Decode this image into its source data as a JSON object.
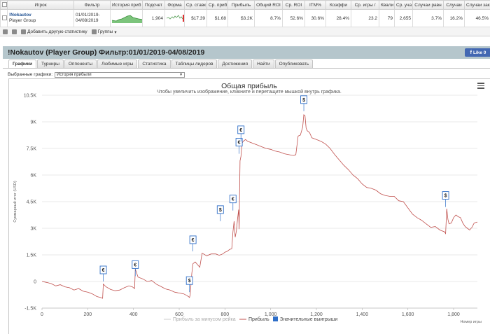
{
  "stats": {
    "columns": [
      "Игрок",
      "Фильтр",
      "История приб",
      "Подсчет",
      "Форма",
      "Ср. ставк",
      "Ср. приб",
      "Прибыль",
      "Общий ROI",
      "Ср. ROI",
      "ITM%",
      "Коэффи",
      "Ср. игры /",
      "Квали",
      "Ср. уча",
      "Случаи равн",
      "Случаи",
      "Случаи зак"
    ],
    "row": {
      "player_name": "!Nokautov",
      "player_group": "Player Group",
      "filter_from": "01/01/2019-",
      "filter_to": "04/08/2019",
      "count": "1,904",
      "avg_stake": "$17.39",
      "avg_profit": "$1.68",
      "profit": "$3.2K",
      "total_roi": "8.7%",
      "avg_roi": "52.6%",
      "itm": "30.6%",
      "coef": "28.4%",
      "avg_games": "23.2",
      "quali": "79",
      "avg_part": "2,655",
      "cases_eq": "3.7%",
      "cases": "16.2%",
      "cases_cl": "46.5%"
    }
  },
  "toolbar": {
    "add_label": "Добавить другую статистику",
    "groups_label": "Группы"
  },
  "header": {
    "title": "!Nokautov (Player Group) Фильтр:01/01/2019-04/08/2019",
    "like_label": "Like 0"
  },
  "tabs": [
    "Графики",
    "Турниры",
    "Оппоненты",
    "Любимые игры",
    "Статистика",
    "Таблицы лидеров",
    "Достижения",
    "Найти",
    "Опубликовать"
  ],
  "selector": {
    "label": "Выбранные графики:",
    "value": "История прибыли"
  },
  "chart_data": {
    "type": "line",
    "title": "Общая прибыль",
    "subtitle": "Чтобы увеличить изображение, кликните и перетащите мышкой внутрь графика.",
    "ylabel": "Суммарный итог (USD)",
    "xlabel": "Номер игры",
    "xlim": [
      0,
      1904
    ],
    "ylim": [
      -1500,
      10500
    ],
    "y_ticks": [
      "-1.5K",
      "0",
      "1.5K",
      "3K",
      "4.5K",
      "6K",
      "7.5K",
      "9K",
      "10.5K"
    ],
    "y_tick_values": [
      -1500,
      0,
      1500,
      3000,
      4500,
      6000,
      7500,
      9000,
      10500
    ],
    "x_ticks": [
      "0",
      "200",
      "400",
      "600",
      "800",
      "1,000",
      "1,200",
      "1,400",
      "1,600",
      "1,800"
    ],
    "x_tick_values": [
      0,
      200,
      400,
      600,
      800,
      1000,
      1200,
      1400,
      1600,
      1800
    ],
    "legend": [
      "Прибыль за минусом рейка",
      "Прибыль",
      "Значительные выигрыши"
    ],
    "legend_colors": [
      "#cccccc",
      "#c0504d",
      "#2f6fc8"
    ],
    "grid": true,
    "series": [
      {
        "name": "Прибыль",
        "color": "#c0504d",
        "x": [
          0,
          20,
          40,
          60,
          80,
          100,
          120,
          140,
          160,
          180,
          200,
          220,
          240,
          255,
          265,
          268,
          280,
          300,
          320,
          340,
          360,
          380,
          395,
          405,
          408,
          420,
          440,
          460,
          480,
          500,
          520,
          540,
          560,
          580,
          600,
          620,
          635,
          640,
          645,
          648,
          655,
          660,
          665,
          670,
          680,
          690,
          700,
          720,
          740,
          760,
          770,
          775,
          780,
          790,
          800,
          810,
          820,
          830,
          835,
          840,
          845,
          850,
          855,
          860,
          862,
          866,
          870,
          875,
          880,
          890,
          900,
          920,
          940,
          960,
          980,
          1000,
          1020,
          1040,
          1060,
          1080,
          1100,
          1110,
          1120,
          1130,
          1140,
          1145,
          1150,
          1155,
          1160,
          1170,
          1180,
          1200,
          1220,
          1240,
          1260,
          1280,
          1300,
          1320,
          1340,
          1360,
          1380,
          1400,
          1420,
          1440,
          1460,
          1480,
          1500,
          1520,
          1540,
          1560,
          1580,
          1600,
          1620,
          1640,
          1660,
          1680,
          1700,
          1720,
          1740,
          1760,
          1765,
          1770,
          1775,
          1780,
          1790,
          1800,
          1810,
          1820,
          1830,
          1840,
          1850,
          1860,
          1870,
          1880,
          1890,
          1904
        ],
        "y": [
          0,
          -50,
          -120,
          -250,
          -180,
          -300,
          -350,
          -480,
          -400,
          -550,
          -600,
          -700,
          -850,
          -900,
          -950,
          -150,
          -300,
          -450,
          -520,
          -480,
          -350,
          -250,
          -300,
          -400,
          700,
          250,
          150,
          0,
          50,
          -150,
          -280,
          -420,
          -480,
          -600,
          -650,
          -700,
          -800,
          -850,
          -900,
          -750,
          450,
          1000,
          1050,
          1100,
          950,
          800,
          1600,
          1450,
          1550,
          1550,
          1500,
          1480,
          1500,
          1550,
          1650,
          1700,
          1800,
          1850,
          2800,
          3400,
          2500,
          2850,
          3500,
          4050,
          2950,
          6800,
          7050,
          7800,
          7900,
          8000,
          7900,
          7800,
          7700,
          7600,
          7500,
          7450,
          7350,
          7300,
          7200,
          7150,
          7100,
          7150,
          8200,
          8250,
          8700,
          9400,
          9350,
          8650,
          8500,
          8400,
          8100,
          8000,
          7900,
          7750,
          7500,
          7150,
          6850,
          6550,
          6300,
          6000,
          5800,
          5500,
          5300,
          5250,
          5150,
          4950,
          4850,
          4800,
          4800,
          4550,
          4500,
          4150,
          3800,
          3600,
          3450,
          3250,
          3050,
          3100,
          2900,
          2800,
          2700,
          4100,
          3500,
          3250,
          3300,
          3600,
          3750,
          3650,
          3600,
          3300,
          3100,
          3000,
          2900,
          3050,
          3300,
          3350
        ]
      }
    ],
    "big_wins": [
      {
        "x": 268,
        "y": 0,
        "symbol": "€"
      },
      {
        "x": 408,
        "y": 300,
        "symbol": "€"
      },
      {
        "x": 645,
        "y": -600,
        "symbol": "$"
      },
      {
        "x": 660,
        "y": 1700,
        "symbol": "€"
      },
      {
        "x": 780,
        "y": 3400,
        "symbol": "$"
      },
      {
        "x": 835,
        "y": 4000,
        "symbol": "€"
      },
      {
        "x": 862,
        "y": 7200,
        "symbol": "€"
      },
      {
        "x": 870,
        "y": 7900,
        "symbol": "€"
      },
      {
        "x": 1145,
        "y": 9600,
        "symbol": "$"
      },
      {
        "x": 1765,
        "y": 4200,
        "symbol": "$"
      }
    ]
  }
}
